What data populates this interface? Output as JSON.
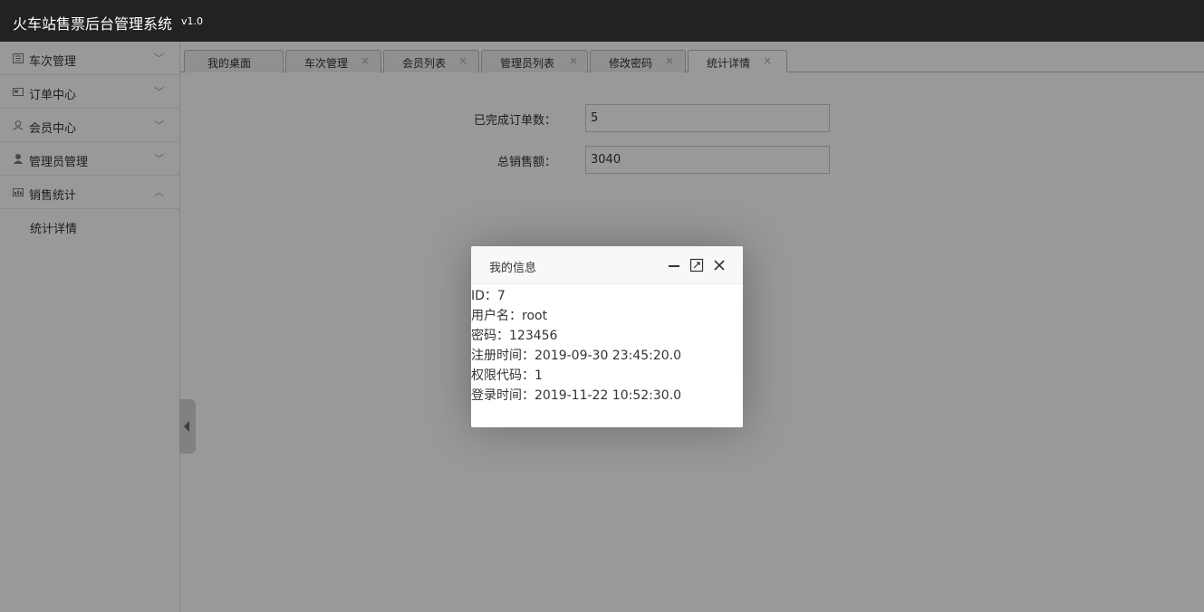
{
  "header": {
    "title": "火车站售票后台管理系统",
    "version": "v1.0"
  },
  "sidebar": {
    "items": [
      {
        "label": "车次管理",
        "icon": "list-icon",
        "chevron": "﹀"
      },
      {
        "label": "订单中心",
        "icon": "image-icon",
        "chevron": "﹀"
      },
      {
        "label": "会员中心",
        "icon": "user-outline-icon",
        "chevron": "﹀"
      },
      {
        "label": "管理员管理",
        "icon": "user-solid-icon",
        "chevron": "﹀"
      },
      {
        "label": "销售统计",
        "icon": "chart-icon",
        "chevron": "︿"
      }
    ],
    "subitem": "统计详情"
  },
  "tabs": [
    {
      "label": "我的桌面"
    },
    {
      "label": "车次管理"
    },
    {
      "label": "会员列表"
    },
    {
      "label": "管理员列表"
    },
    {
      "label": "修改密码"
    },
    {
      "label": "统计详情"
    }
  ],
  "form": {
    "completed_label": "已完成订单数：",
    "completed_value": "5",
    "sales_label": "总销售额：",
    "sales_value": "3040"
  },
  "dialog": {
    "title": "我的信息",
    "lines": [
      "ID：7",
      "用户名：root",
      "密码：123456",
      "注册时间：2019-09-30 23:45:20.0",
      "权限代码：1",
      "登录时间：2019-11-22 10:52:30.0"
    ]
  },
  "colors": {
    "header_bg": "#222222",
    "overlay": "rgba(0,0,0,0.4)"
  }
}
